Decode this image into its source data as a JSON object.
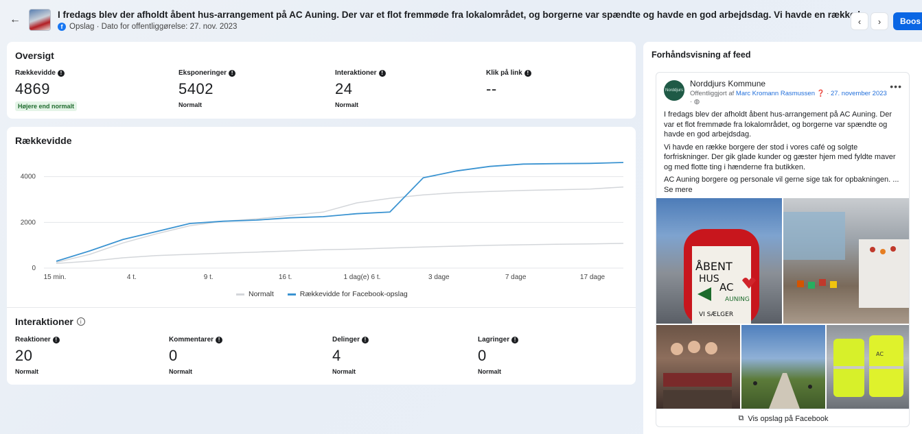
{
  "header": {
    "title": "I fredags blev der afholdt åbent hus-arrangement på AC Auning. Der var et flot fremmøde fra lokalområdet, og borgerne var spændte og havde en god arbejdsdag. Vi havde en række borgere der stod i vores…",
    "meta": "Opslag · Dato for offentliggørelse: 27. nov. 2023",
    "boost_label": "Boos",
    "prev_icon": "chevron-left-icon",
    "next_icon": "chevron-right-icon"
  },
  "overview": {
    "title": "Oversigt",
    "metrics": [
      {
        "label": "Rækkevidde",
        "value": "4869",
        "status": "Højere end normalt"
      },
      {
        "label": "Eksponeringer",
        "value": "5402",
        "status": "Normalt"
      },
      {
        "label": "Interaktioner",
        "value": "24",
        "status": "Normalt"
      },
      {
        "label": "Klik på link",
        "value": "--",
        "status": ""
      }
    ]
  },
  "reach_chart": {
    "title": "Rækkevidde"
  },
  "chart_data": {
    "type": "line",
    "title": "Rækkevidde",
    "categories": [
      "15 min.",
      "4 t.",
      "9 t.",
      "16 t.",
      "1 dag(e) 6 t.",
      "3 dage",
      "7 dage",
      "17 dage"
    ],
    "yticks": [
      0,
      2000,
      4000
    ],
    "ylim": [
      0,
      4800
    ],
    "grid": true,
    "legend_position": "bottom",
    "series": [
      {
        "name": "Normalt",
        "color": "#d3d6da",
        "values": [
          200,
          300,
          450,
          550,
          600,
          650,
          700,
          750,
          800,
          830,
          880,
          920,
          960,
          1000,
          1020,
          1040,
          1060,
          1080
        ]
      },
      {
        "name": "Normalt",
        "color": "#d3d6da",
        "values": [
          250,
          600,
          1100,
          1500,
          1850,
          2050,
          2150,
          2300,
          2450,
          2850,
          3050,
          3200,
          3300,
          3350,
          3400,
          3430,
          3460,
          3550
        ]
      },
      {
        "name": "Rækkevidde for Facebook-opslag",
        "color": "#3a93d1",
        "values": [
          300,
          750,
          1250,
          1600,
          1950,
          2050,
          2100,
          2200,
          2250,
          2380,
          2450,
          3950,
          4250,
          4450,
          4550,
          4570,
          4580,
          4620
        ]
      }
    ]
  },
  "legend": {
    "normal": "Normalt",
    "facebook": "Rækkevidde for Facebook-opslag"
  },
  "interactions": {
    "title": "Interaktioner",
    "metrics": [
      {
        "label": "Reaktioner",
        "value": "20",
        "status": "Normalt"
      },
      {
        "label": "Kommentarer",
        "value": "0",
        "status": "Normalt"
      },
      {
        "label": "Delinger",
        "value": "4",
        "status": "Normalt"
      },
      {
        "label": "Lagringer",
        "value": "0",
        "status": "Normalt"
      }
    ]
  },
  "feed": {
    "title": "Forhåndsvisning af feed",
    "page_name": "Norddjurs Kommune",
    "published_by": "Offentliggjort af",
    "author": "Marc Kromann Rasmussen",
    "date": "27. november 2023",
    "paragraphs": [
      "I fredags blev der afholdt åbent hus-arrangement på AC Auning. Der var et flot fremmøde fra lokalområdet, og borgerne var spændte og havde en god arbejdsdag.",
      "Vi havde en række borgere der stod i vores café og solgte forfriskninger. Der gik glade kunder og gæster hjem med fyldte maver og med flotte ting i hænderne fra butikken.",
      "AC Auning borgere og personale vil gerne sige tak for opbakningen. ..."
    ],
    "see_more": "Se mere",
    "view_on_facebook": "Vis opslag på Facebook",
    "sign_text": [
      "ÅBENT",
      "HUS",
      "AC",
      "AUNING",
      "VI SÆLGER"
    ]
  }
}
